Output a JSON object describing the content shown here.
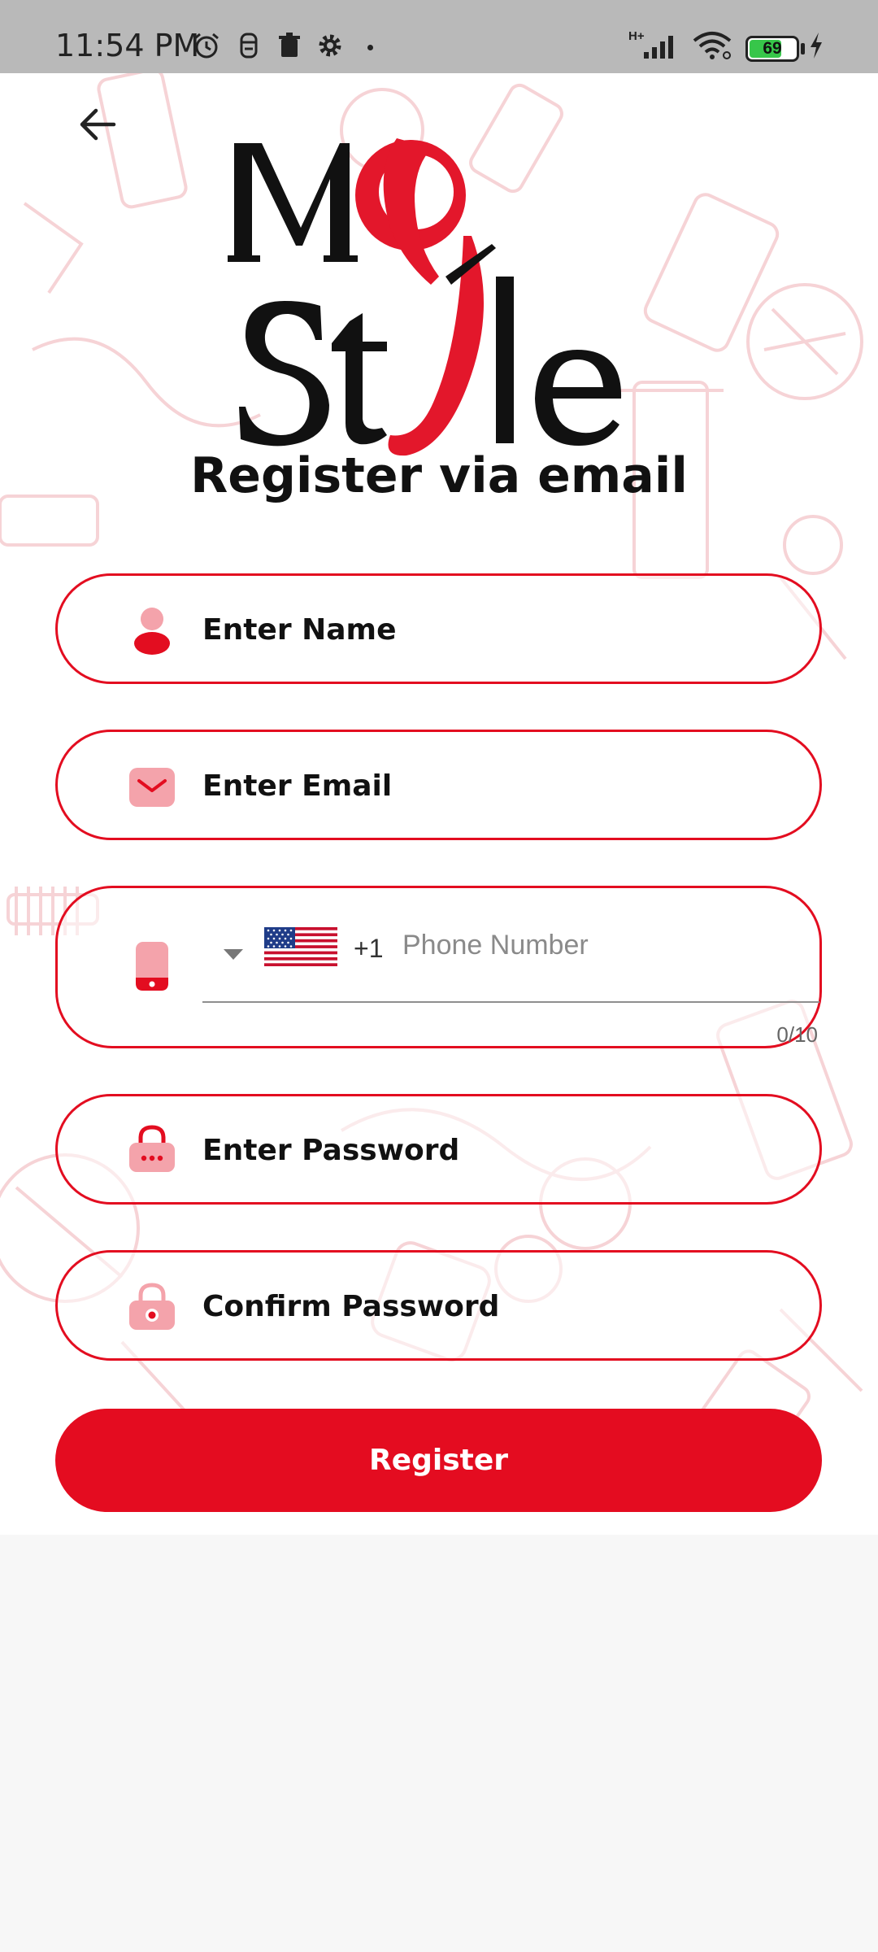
{
  "status_bar": {
    "time": "11:54 PM",
    "network_label": "H+",
    "battery_level": "69",
    "battery_fraction": 0.69
  },
  "header": {
    "back_icon": "arrow-left-icon",
    "logo_text": "My Style"
  },
  "title": "Register via email",
  "form": {
    "name": {
      "label": "Enter Name",
      "icon": "person-icon"
    },
    "email": {
      "label": "Enter Email",
      "icon": "envelope-icon"
    },
    "phone": {
      "icon": "phone-icon",
      "country_flag": "us-flag-icon",
      "dial_code": "+1",
      "placeholder": "Phone Number",
      "value": "",
      "counter": "0/10"
    },
    "password": {
      "label": "Enter Password",
      "icon": "lock-icon"
    },
    "confirm_password": {
      "label": "Confirm Password",
      "icon": "lock-icon"
    }
  },
  "register_label": "Register",
  "colors": {
    "accent": "#e40c20",
    "icon_pink": "#f4a3ab",
    "status_bar": "#b9b9b9",
    "lower_background": "#f7f7f7"
  }
}
